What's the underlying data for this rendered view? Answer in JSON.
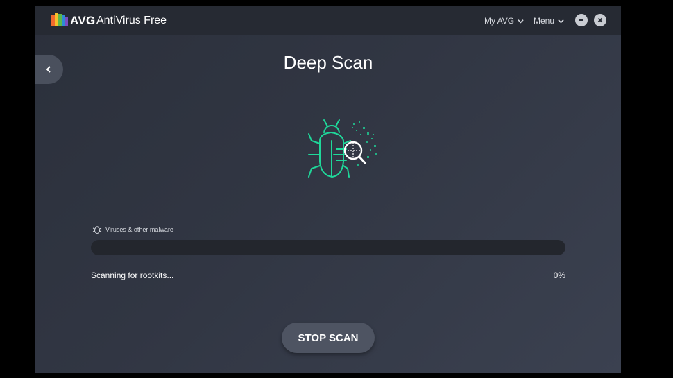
{
  "app": {
    "brand": "AVG",
    "product": "AntiVirus Free"
  },
  "titlebar": {
    "my_avg": "My AVG",
    "menu": "Menu",
    "minimize_icon": "minus-icon",
    "close_icon": "close-icon"
  },
  "nav": {
    "back_icon": "chevron-left-icon"
  },
  "scan": {
    "title": "Deep Scan",
    "category": "Viruses & other malware",
    "status": "Scanning for rootkits...",
    "percent_text": "0%",
    "progress": 0
  },
  "actions": {
    "stop_label": "STOP SCAN"
  },
  "colors": {
    "accent": "#1fd89a",
    "background": "#2e333e",
    "titlebar": "#262a33"
  }
}
